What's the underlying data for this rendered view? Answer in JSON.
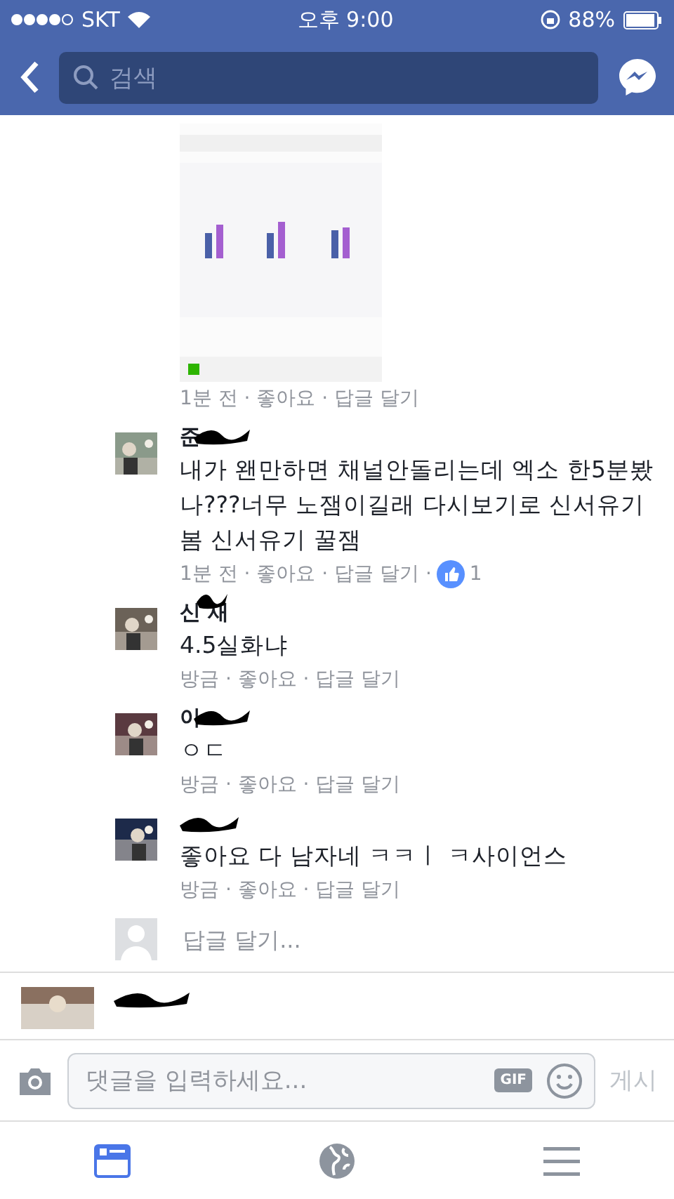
{
  "status_bar": {
    "carrier": "SKT",
    "time": "오후 9:00",
    "battery": "88%"
  },
  "search": {
    "placeholder": "검색"
  },
  "attachment": {
    "kind": "picture",
    "meta": "1분 전 · 좋아요 · 답글 달기"
  },
  "comments": [
    {
      "name_parts": [
        "준"
      ],
      "kind": "tailhidden",
      "text": "내가 왠만하면 채널안돌리는데 엑소 한5분봤나???너무 노잼이길래 다시보기로 신서유기봄 신서유기 꿀잼",
      "meta": "1분 전 · 좋아요 · 답글 달기 ·",
      "likes": "1"
    },
    {
      "name_parts": [
        "신",
        "재"
      ],
      "kind": "middlehidden",
      "text": "4.5실화냐",
      "meta": "방금 · 좋아요 · 답글 달기"
    },
    {
      "name_parts": [
        "이"
      ],
      "kind": "tailhidden",
      "text": "ㅇㄷ",
      "meta": "방금 · 좋아요 · 답글 달기"
    },
    {
      "kind": "hidden",
      "text": "좋아요 다 남자네 ㅋㅋㅣ ㅋ사이언스",
      "meta": "방금 · 좋아요 · 답글 달기"
    }
  ],
  "reply": {
    "placeholder": "답글 달기..."
  },
  "composer": {
    "placeholder": "댓글을 입력하세요...",
    "gif": "GIF",
    "post": "게시"
  },
  "tabs": [
    {
      "kind": "feed",
      "selected": true
    },
    {
      "kind": "globe",
      "selected": false
    },
    {
      "kind": "menu",
      "selected": false
    }
  ]
}
